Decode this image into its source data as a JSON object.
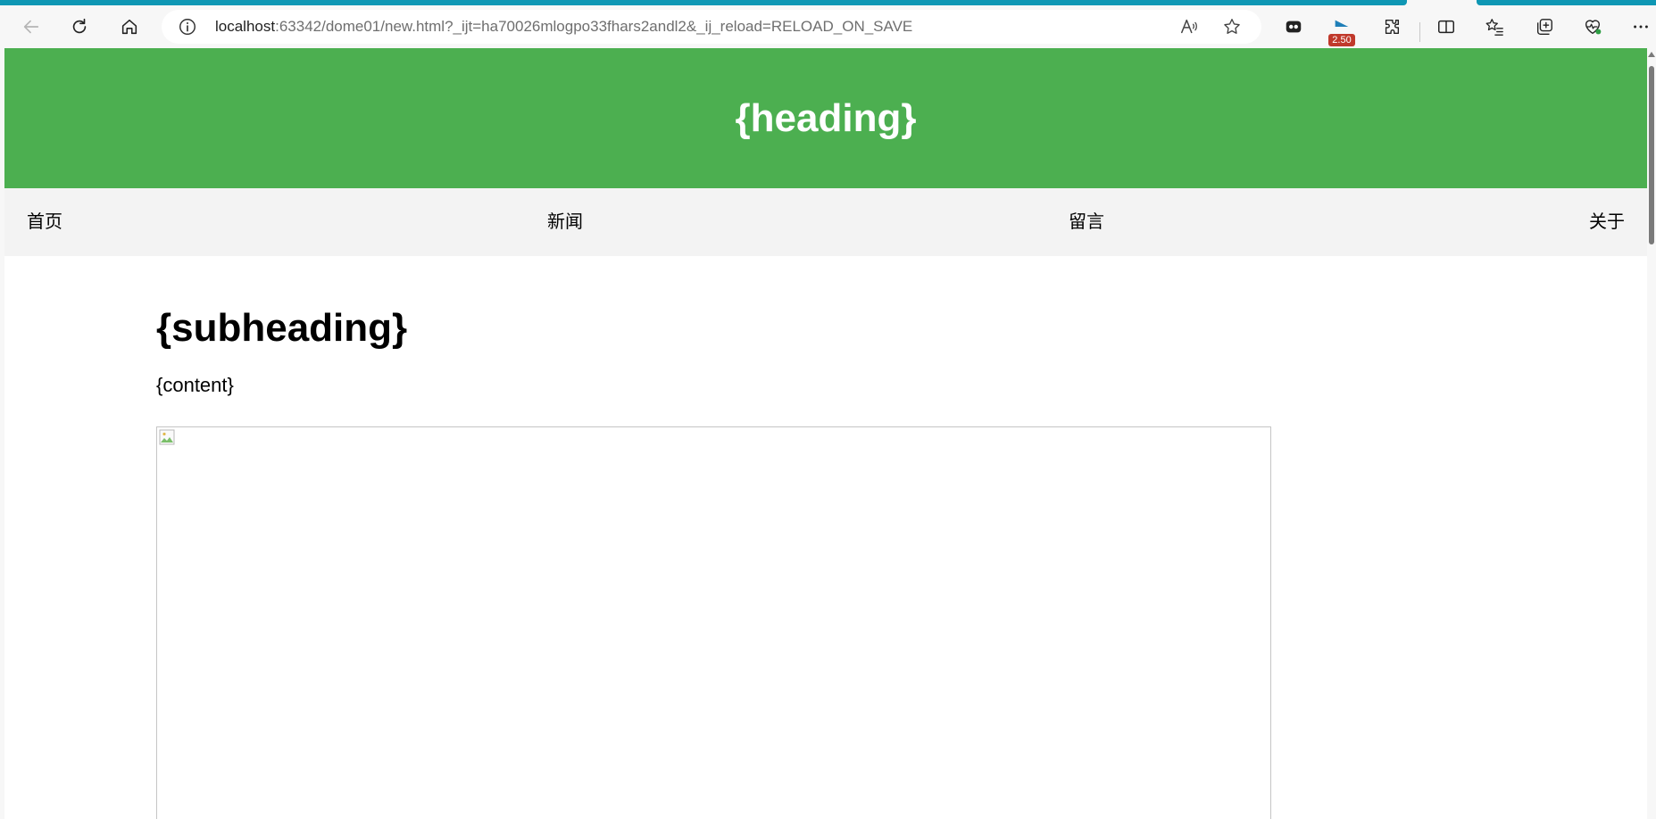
{
  "browser": {
    "url_host": "localhost",
    "url_rest": ":63342/dome01/new.html?_ijt=ha70026mlogpo33fhars2andl2&_ij_reload=RELOAD_ON_SAVE",
    "extension_badge": "2.50"
  },
  "page": {
    "heading": "{heading}",
    "nav": {
      "items": [
        "首页",
        "新闻",
        "留言",
        "关于"
      ]
    },
    "subheading": "{subheading}",
    "content": "{content}"
  },
  "colors": {
    "header_bg": "#4caf50",
    "nav_bg": "#f3f3f3",
    "tab_accent": "#0f97b4"
  },
  "icons": {
    "back": "back-arrow-icon",
    "refresh": "refresh-icon",
    "home": "home-icon",
    "info": "info-icon",
    "read_aloud": "read-aloud-icon",
    "favorite": "star-icon",
    "extensions": "puzzle-icon",
    "split_screen": "split-screen-icon",
    "favorites_list": "favorites-list-icon",
    "collections": "collections-icon",
    "health": "browser-essentials-icon",
    "menu": "more-icon"
  }
}
